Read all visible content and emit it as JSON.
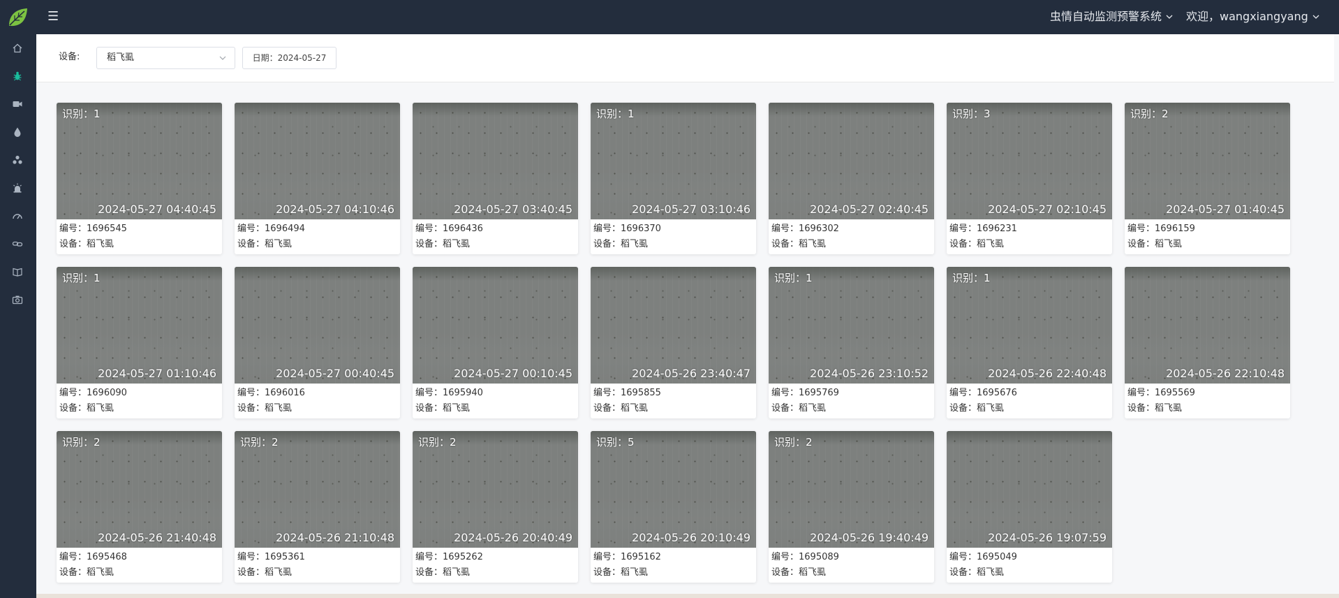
{
  "header": {
    "system_name": "虫情自动监测预警系统",
    "welcome": "欢迎，wangxiangyang",
    "menu_icon": "☰"
  },
  "sidebar": {
    "items": [
      {
        "icon": "home-icon",
        "active": false
      },
      {
        "icon": "bug-icon",
        "active": true
      },
      {
        "icon": "video-camera-icon",
        "active": false
      },
      {
        "icon": "water-drop-icon",
        "active": false
      },
      {
        "icon": "cluster-icon",
        "active": false
      },
      {
        "icon": "alarm-light-icon",
        "active": false
      },
      {
        "icon": "gauge-icon",
        "active": false
      },
      {
        "icon": "link-icon",
        "active": false
      },
      {
        "icon": "book-icon",
        "active": false
      },
      {
        "icon": "camera-icon",
        "active": false
      }
    ]
  },
  "colors": {
    "header_bg": "#232d3d",
    "active_icon": "#1abc9c",
    "icon_default": "#aab4c1",
    "logo_green": "#7cc242"
  },
  "filters": {
    "device_label": "设备:",
    "device_value": "稻飞虱",
    "date_button": "日期：2024-05-27"
  },
  "cards": [
    {
      "count_label": "识别：1",
      "timestamp": "2024-05-27 04:40:45",
      "id_label": "编号：1696545",
      "device_label": "设备：稻飞虱"
    },
    {
      "count_label": "",
      "timestamp": "2024-05-27 04:10:46",
      "id_label": "编号：1696494",
      "device_label": "设备：稻飞虱"
    },
    {
      "count_label": "",
      "timestamp": "2024-05-27 03:40:45",
      "id_label": "编号：1696436",
      "device_label": "设备：稻飞虱"
    },
    {
      "count_label": "识别：1",
      "timestamp": "2024-05-27 03:10:46",
      "id_label": "编号：1696370",
      "device_label": "设备：稻飞虱"
    },
    {
      "count_label": "",
      "timestamp": "2024-05-27 02:40:45",
      "id_label": "编号：1696302",
      "device_label": "设备：稻飞虱"
    },
    {
      "count_label": "识别：3",
      "timestamp": "2024-05-27 02:10:45",
      "id_label": "编号：1696231",
      "device_label": "设备：稻飞虱"
    },
    {
      "count_label": "识别：2",
      "timestamp": "2024-05-27 01:40:45",
      "id_label": "编号：1696159",
      "device_label": "设备：稻飞虱"
    },
    {
      "count_label": "识别：1",
      "timestamp": "2024-05-27 01:10:46",
      "id_label": "编号：1696090",
      "device_label": "设备：稻飞虱"
    },
    {
      "count_label": "",
      "timestamp": "2024-05-27 00:40:45",
      "id_label": "编号：1696016",
      "device_label": "设备：稻飞虱"
    },
    {
      "count_label": "",
      "timestamp": "2024-05-27 00:10:45",
      "id_label": "编号：1695940",
      "device_label": "设备：稻飞虱"
    },
    {
      "count_label": "",
      "timestamp": "2024-05-26 23:40:47",
      "id_label": "编号：1695855",
      "device_label": "设备：稻飞虱"
    },
    {
      "count_label": "识别：1",
      "timestamp": "2024-05-26 23:10:52",
      "id_label": "编号：1695769",
      "device_label": "设备：稻飞虱"
    },
    {
      "count_label": "识别：1",
      "timestamp": "2024-05-26 22:40:48",
      "id_label": "编号：1695676",
      "device_label": "设备：稻飞虱"
    },
    {
      "count_label": "",
      "timestamp": "2024-05-26 22:10:48",
      "id_label": "编号：1695569",
      "device_label": "设备：稻飞虱"
    },
    {
      "count_label": "识别：2",
      "timestamp": "2024-05-26 21:40:48",
      "id_label": "编号：1695468",
      "device_label": "设备：稻飞虱"
    },
    {
      "count_label": "识别：2",
      "timestamp": "2024-05-26 21:10:48",
      "id_label": "编号：1695361",
      "device_label": "设备：稻飞虱"
    },
    {
      "count_label": "识别：2",
      "timestamp": "2024-05-26 20:40:49",
      "id_label": "编号：1695262",
      "device_label": "设备：稻飞虱"
    },
    {
      "count_label": "识别：5",
      "timestamp": "2024-05-26 20:10:49",
      "id_label": "编号：1695162",
      "device_label": "设备：稻飞虱"
    },
    {
      "count_label": "识别：2",
      "timestamp": "2024-05-26 19:40:49",
      "id_label": "编号：1695089",
      "device_label": "设备：稻飞虱"
    },
    {
      "count_label": "",
      "timestamp": "2024-05-26 19:07:59",
      "id_label": "编号：1695049",
      "device_label": "设备：稻飞虱"
    }
  ]
}
